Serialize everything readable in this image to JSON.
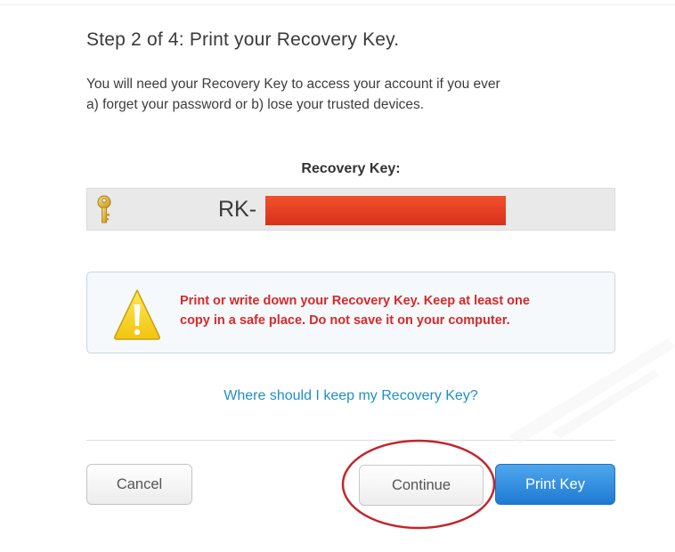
{
  "dialog": {
    "title": "Step 2 of 4: Print your Recovery Key.",
    "intro_line1": "You will need your Recovery Key to access your account if you ever",
    "intro_line2": "a) forget your password or b) lose your trusted devices."
  },
  "recovery_key": {
    "label": "Recovery Key:",
    "prefix": "RK-",
    "icon": "key-icon",
    "redaction_color": "#e23a20"
  },
  "warning": {
    "icon": "warning-icon",
    "line1": "Print or write down your Recovery Key. Keep at least one",
    "line2": "copy in a safe place. Do not save it on your computer.",
    "text_color": "#d62a2a"
  },
  "help_link": {
    "label": "Where should I keep my Recovery Key?",
    "color": "#1e8fc6"
  },
  "buttons": {
    "cancel": "Cancel",
    "continue": "Continue",
    "print_key": "Print Key",
    "primary_color": "#2a86dc"
  },
  "annotation": {
    "color": "#c0262c",
    "shape": "ellipse"
  }
}
